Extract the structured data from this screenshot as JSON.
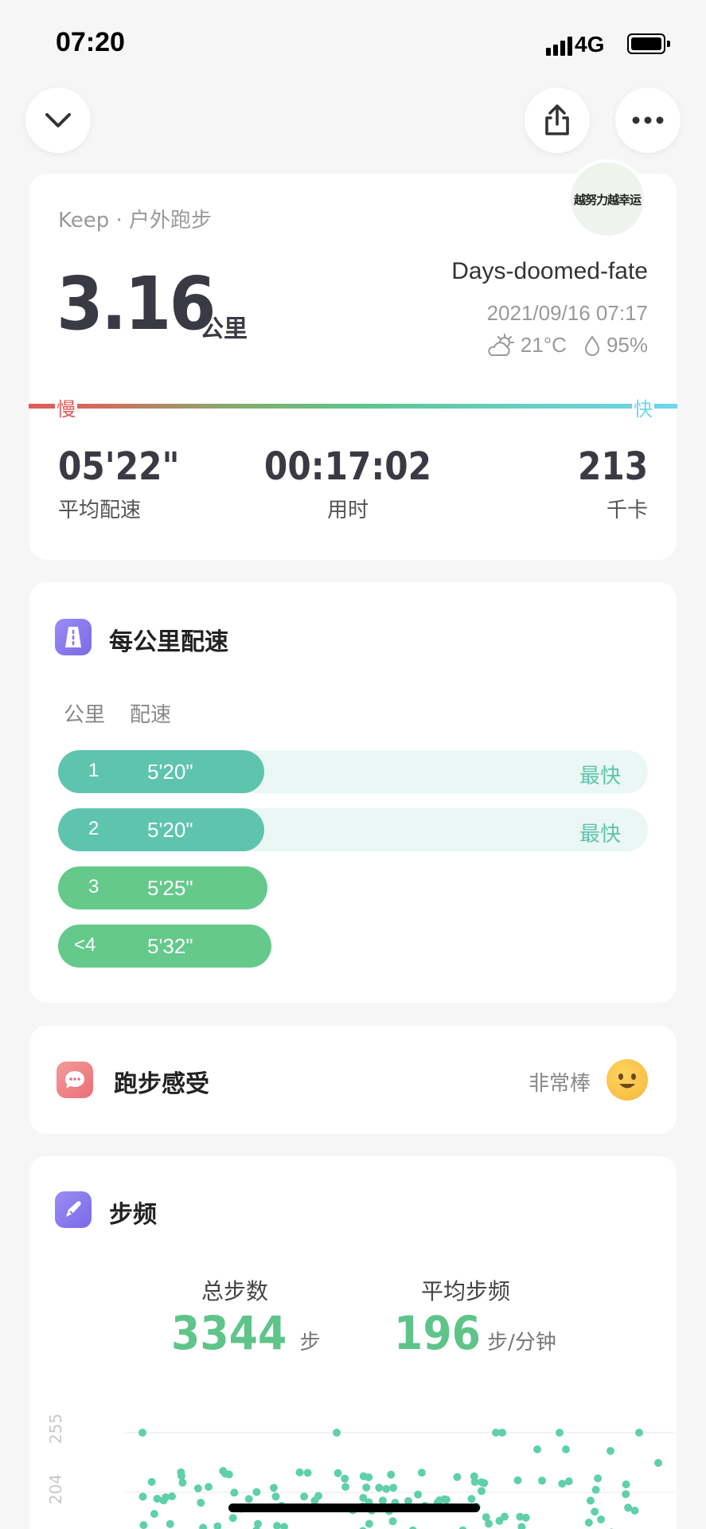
{
  "status": {
    "time": "07:20",
    "network": "4G"
  },
  "header": {
    "back_icon": "chevron-down-icon",
    "share_icon": "share-icon",
    "more_icon": "more-icon"
  },
  "summary": {
    "source": "Keep · 户外跑步",
    "distance": "3.16",
    "distance_unit": "公里",
    "username": "Days-doomed-fate",
    "datetime": "2021/09/16 07:17",
    "temperature": "21°C",
    "humidity": "95%",
    "avatar_text": "越努力越幸运",
    "speed_slow": "慢",
    "speed_fast": "快",
    "stats": [
      {
        "value": "05'22\"",
        "label": "平均配速"
      },
      {
        "value": "00:17:02",
        "label": "用时"
      },
      {
        "value": "213",
        "label": "千卡"
      }
    ]
  },
  "pace_card": {
    "title": "每公里配速",
    "col_km": "公里",
    "col_pace": "配速",
    "rows": [
      {
        "km": "1",
        "pace": "5'20\"",
        "tag": "最快",
        "fill": 0.35
      },
      {
        "km": "2",
        "pace": "5'20\"",
        "tag": "最快",
        "fill": 0.35
      },
      {
        "km": "3",
        "pace": "5'25\"",
        "tag": "",
        "fill": 0.355
      },
      {
        "km": "<4",
        "pace": "5'32\"",
        "tag": "",
        "fill": 0.362
      }
    ]
  },
  "feeling_card": {
    "title": "跑步感受",
    "value": "非常棒"
  },
  "cadence_card": {
    "title": "步频",
    "total_steps_label": "总步数",
    "total_steps": "3344",
    "total_steps_unit": "步",
    "avg_cadence_label": "平均步频",
    "avg_cadence": "196",
    "avg_cadence_unit": "步/分钟",
    "y_ticks": [
      "255",
      "204"
    ]
  },
  "colors": {
    "slow": "#e05a5a",
    "mid": "#5fc48a",
    "fast": "#6fd6ee",
    "pace_fast_bar": "#5fc4ad",
    "pace_bar": "#64c98a",
    "dot_green": "#5fd0aa",
    "dot_orange": "#f0a962"
  }
}
